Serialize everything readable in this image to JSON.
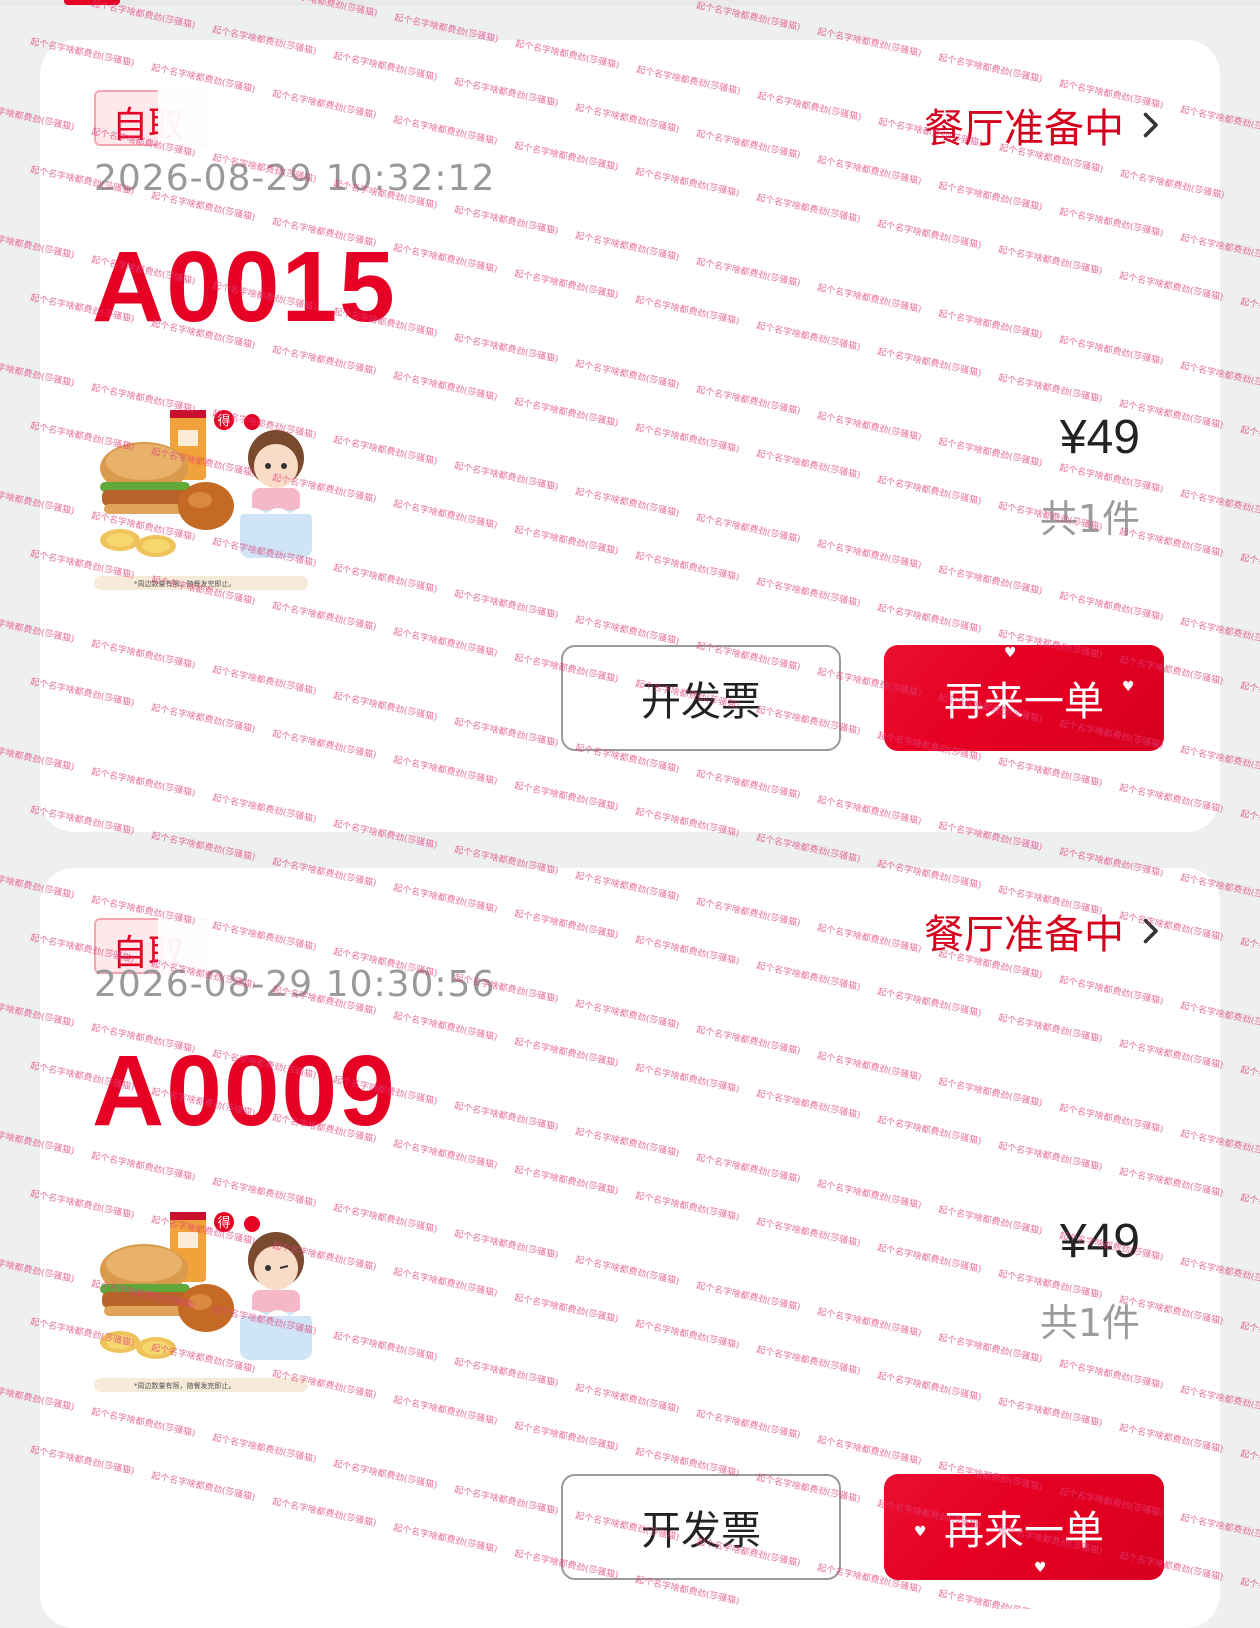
{
  "orders": [
    {
      "tag": "自取",
      "status": "餐厅准备中",
      "datetime": "2026-08-29 10:32:12",
      "order_no": "A0015",
      "product_note": "*周边数量有限，随餐发完即止。",
      "badge": "得",
      "price": "¥49",
      "quantity": "共1件",
      "invoice_label": "开发票",
      "reorder_label": "再来一单"
    },
    {
      "tag": "自取",
      "status": "餐厅准备中",
      "datetime": "2026-08-29 10:30:56",
      "order_no": "A0009",
      "product_note": "*周边数量有限，随餐发完即止。",
      "badge": "得",
      "price": "¥49",
      "quantity": "共1件",
      "invoice_label": "开发票",
      "reorder_label": "再来一单"
    }
  ],
  "watermark_text": "起个名字啥都费劲(莎骚猫)",
  "colors": {
    "accent": "#e60023",
    "status_text": "#d4001e",
    "muted_text": "#999999",
    "background": "#eeeff1",
    "card": "#ffffff",
    "watermark": "#e0407a"
  },
  "icons": [
    "chevron-right-icon"
  ]
}
